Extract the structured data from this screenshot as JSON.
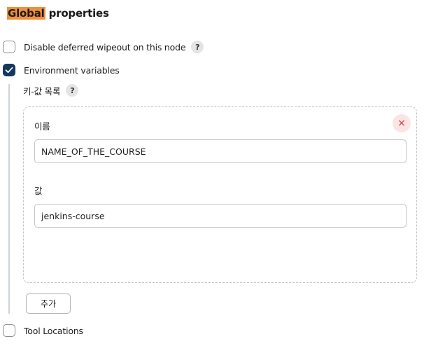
{
  "section": {
    "title_highlight": "Global",
    "title_rest": " properties"
  },
  "options": {
    "disable_wipeout": {
      "label": "Disable deferred wipeout on this node",
      "checked": false,
      "help": "?"
    },
    "env_vars": {
      "label": "Environment variables",
      "checked": true
    },
    "tool_locations": {
      "label": "Tool Locations",
      "checked": false
    }
  },
  "env_section": {
    "list_label": "키-값 목록",
    "help": "?",
    "entry": {
      "name_label": "이름",
      "name_value": "NAME_OF_THE_COURSE",
      "value_label": "값",
      "value_value": "jenkins-course",
      "delete_glyph": "×"
    },
    "add_label": "추가"
  },
  "colors": {
    "highlight": "#f0913a",
    "checkbox_checked": "#16375e",
    "delete_bg": "#fde4e4",
    "delete_fg": "#d0393e"
  }
}
